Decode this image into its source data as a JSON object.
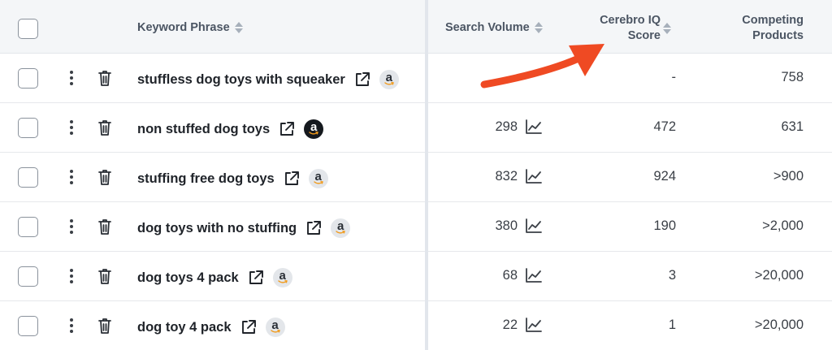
{
  "header": {
    "keyword_phrase": "Keyword Phrase",
    "search_volume": "Search Volume",
    "cerebro_iq_line1": "Cerebro IQ",
    "cerebro_iq_line2": "Score",
    "competing_line1": "Competing",
    "competing_line2": "Products"
  },
  "rows": [
    {
      "keyword": "stuffless dog toys with squeaker",
      "search_volume": "",
      "cerebro_iq": "-",
      "competing": "758",
      "amazon_badge": "a",
      "badge_style": "light"
    },
    {
      "keyword": "non stuffed dog toys",
      "search_volume": "298",
      "cerebro_iq": "472",
      "competing": "631",
      "amazon_badge": "a",
      "badge_style": "dark"
    },
    {
      "keyword": "stuffing free dog toys",
      "search_volume": "832",
      "cerebro_iq": "924",
      "competing": ">900",
      "amazon_badge": "a",
      "badge_style": "light"
    },
    {
      "keyword": "dog toys with no stuffing",
      "search_volume": "380",
      "cerebro_iq": "190",
      "competing": ">2,000",
      "amazon_badge": "a",
      "badge_style": "light"
    },
    {
      "keyword": "dog toys 4 pack",
      "search_volume": "68",
      "cerebro_iq": "3",
      "competing": ">20,000",
      "amazon_badge": "a",
      "badge_style": "light"
    },
    {
      "keyword": "dog toy 4 pack",
      "search_volume": "22",
      "cerebro_iq": "1",
      "competing": ">20,000",
      "amazon_badge": "a",
      "badge_style": "light"
    }
  ],
  "colors": {
    "annotation_arrow": "#ef4a23",
    "header_bg": "#f4f6f8",
    "divider": "#e2e6ec"
  },
  "icons": {
    "row_menu": "kebab-icon",
    "row_delete": "trash-icon",
    "open_link": "external-link-icon",
    "amazon": "amazon-icon",
    "trend": "trend-chart-icon",
    "sort": "sort-icon",
    "annotation": "red-arrow"
  }
}
